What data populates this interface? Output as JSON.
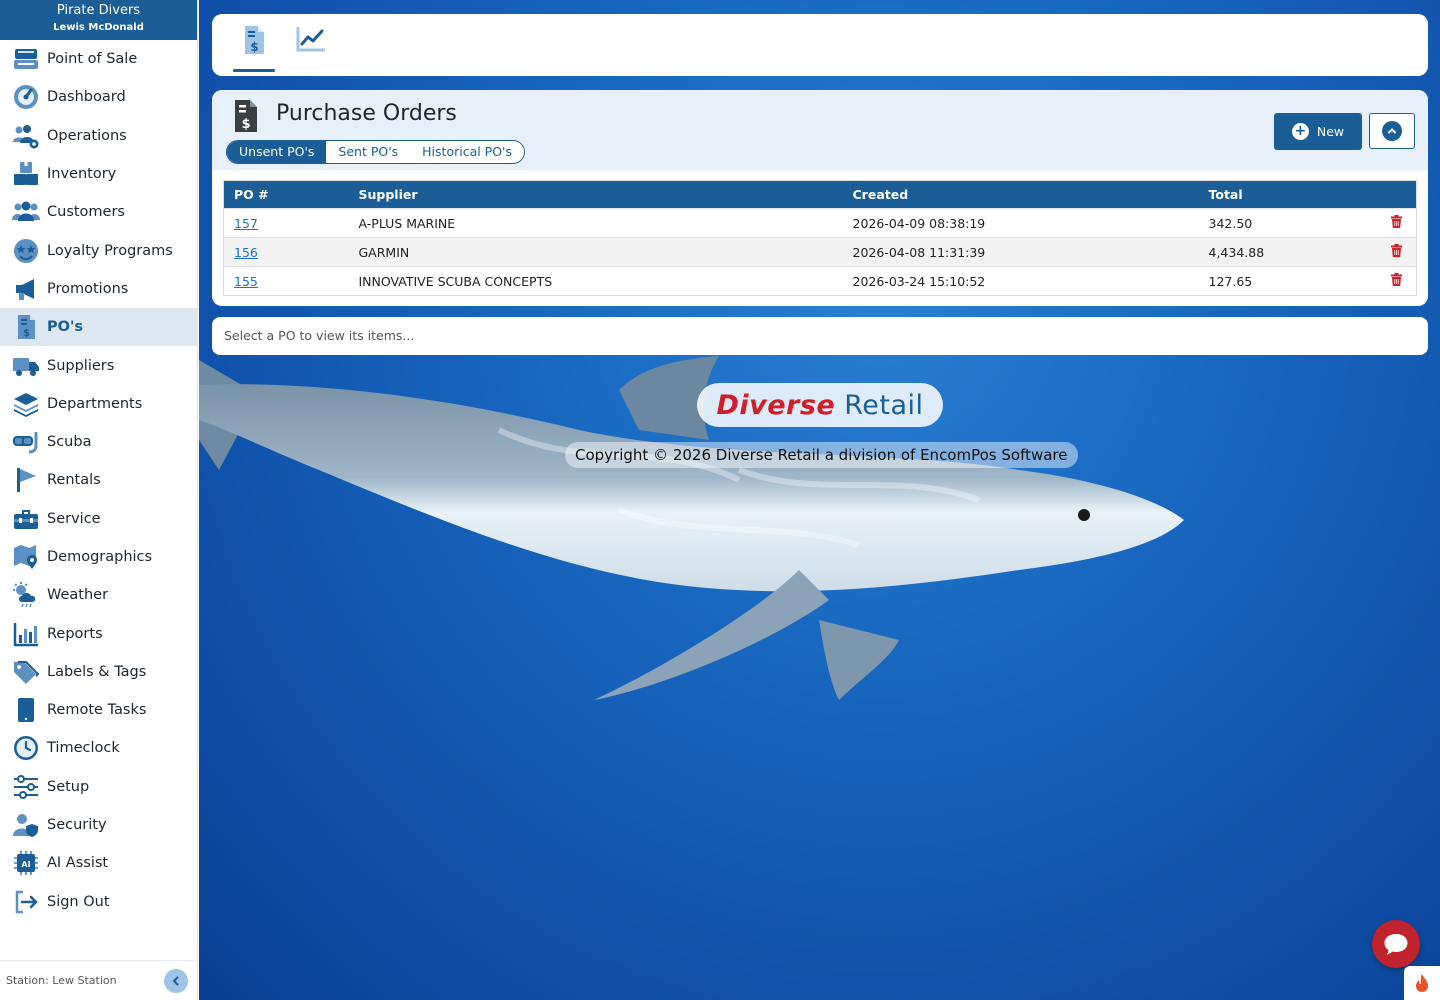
{
  "sidebar": {
    "business_name": "Pirate Divers",
    "user_name": "Lewis McDonald",
    "items": [
      {
        "label": "Point of Sale",
        "icon": "register-icon"
      },
      {
        "label": "Dashboard",
        "icon": "speedometer-icon"
      },
      {
        "label": "Operations",
        "icon": "users-gear-icon"
      },
      {
        "label": "Inventory",
        "icon": "boxes-icon"
      },
      {
        "label": "Customers",
        "icon": "users-icon"
      },
      {
        "label": "Loyalty Programs",
        "icon": "star-face-icon"
      },
      {
        "label": "Promotions",
        "icon": "megaphone-icon"
      },
      {
        "label": "PO's",
        "icon": "invoice-dollar-icon"
      },
      {
        "label": "Suppliers",
        "icon": "truck-icon"
      },
      {
        "label": "Departments",
        "icon": "layers-icon"
      },
      {
        "label": "Scuba",
        "icon": "dive-mask-icon"
      },
      {
        "label": "Rentals",
        "icon": "flag-icon"
      },
      {
        "label": "Service",
        "icon": "toolbox-icon"
      },
      {
        "label": "Demographics",
        "icon": "map-pin-icon"
      },
      {
        "label": "Weather",
        "icon": "weather-icon"
      },
      {
        "label": "Reports",
        "icon": "bar-chart-icon"
      },
      {
        "label": "Labels & Tags",
        "icon": "tags-icon"
      },
      {
        "label": "Remote Tasks",
        "icon": "tablet-icon"
      },
      {
        "label": "Timeclock",
        "icon": "clock-icon"
      },
      {
        "label": "Setup",
        "icon": "sliders-icon"
      },
      {
        "label": "Security",
        "icon": "user-shield-icon"
      },
      {
        "label": "AI Assist",
        "icon": "ai-chip-icon"
      },
      {
        "label": "Sign Out",
        "icon": "sign-out-icon"
      }
    ],
    "active_item": "PO's",
    "station": "Station: Lew Station"
  },
  "toolbar": {
    "tabs": [
      {
        "icon": "invoice-dollar-icon",
        "active": true
      },
      {
        "icon": "line-chart-icon",
        "active": false
      }
    ]
  },
  "purchase_orders": {
    "title": "Purchase Orders",
    "tabs": [
      "Unsent PO's",
      "Sent PO's",
      "Historical PO's"
    ],
    "active_tab": "Unsent PO's",
    "new_button": "New",
    "columns": [
      "PO #",
      "Supplier",
      "Created",
      "Total"
    ],
    "rows": [
      {
        "po": "157",
        "supplier": "A-PLUS MARINE",
        "created": "2026-04-09 08:38:19",
        "total": "342.50"
      },
      {
        "po": "156",
        "supplier": "GARMIN",
        "created": "2026-04-08 11:31:39",
        "total": "4,434.88"
      },
      {
        "po": "155",
        "supplier": "INNOVATIVE SCUBA CONCEPTS",
        "created": "2026-03-24 15:10:52",
        "total": "127.65"
      }
    ]
  },
  "items_hint": "Select a PO to view its items...",
  "brand": {
    "name_part1": "Diverse",
    "name_part2": "Retail",
    "copyright": "Copyright © 2026 Diverse Retail a division of EncomPos Software"
  },
  "colors": {
    "primary": "#1b5d97",
    "delete": "#d0212b",
    "chat": "#c0232b"
  }
}
